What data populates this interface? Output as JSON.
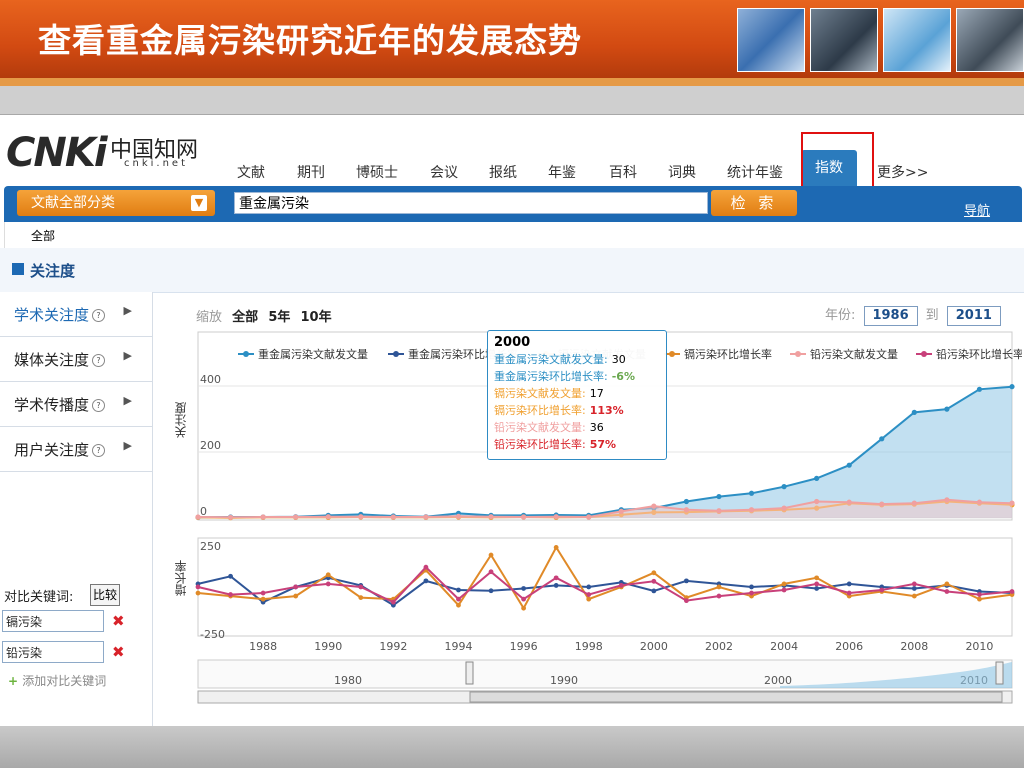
{
  "slide": {
    "title": "查看重金属污染研究近年的发展态势",
    "thumbnails": [
      "lab-photo",
      "researcher-photo",
      "world-map-photo",
      "classroom-photo"
    ]
  },
  "logo": {
    "main": "CNKi",
    "cn": "中国知网",
    "sub": "cnki.net"
  },
  "nav": {
    "items": [
      "文献",
      "期刊",
      "博硕士",
      "会议",
      "报纸",
      "年鉴",
      "百科",
      "词典",
      "统计年鉴",
      "指数",
      "更多>>"
    ],
    "active": "指数"
  },
  "search": {
    "category": "文献全部分类",
    "query": "重金属污染",
    "button": "检 索",
    "nav_link": "导航",
    "scope": "全部"
  },
  "section": {
    "title": "关注度"
  },
  "menu": [
    {
      "label": "学术关注度"
    },
    {
      "label": "媒体关注度"
    },
    {
      "label": "学术传播度"
    },
    {
      "label": "用户关注度"
    }
  ],
  "compare": {
    "label": "对比关键词:",
    "button": "比较",
    "keywords": [
      "镉污染",
      "铅污染"
    ],
    "add": "添加对比关键词"
  },
  "controls": {
    "zoom_label": "缩放",
    "zoom_options": [
      "全部",
      "5年",
      "10年"
    ],
    "year_label": "年份:",
    "year_from": "1986",
    "year_to_label": "到",
    "year_to": "2011"
  },
  "colors": {
    "heavy": "#2c8fc4",
    "heavy_rate": "#2f5597",
    "cd": "#f0a030",
    "cd_rate": "#e08a28",
    "pb": "#f0a0a0",
    "pb_rate": "#c8407a"
  },
  "chart_data": {
    "type": "line",
    "xlim": [
      1986,
      2011
    ],
    "legend": [
      "重金属污染文献发文量",
      "重金属污染环比增长率",
      "镉污染文献发文量",
      "镉污染环比增长率",
      "铅污染文献发文量",
      "铅污染环比增长率"
    ],
    "upper": {
      "ylabel": "关注度",
      "yticks": [
        0,
        200,
        400
      ],
      "series": [
        {
          "name": "重金属污染文献发文量",
          "x": [
            1986,
            1987,
            1988,
            1989,
            1990,
            1991,
            1992,
            1993,
            1994,
            1995,
            1996,
            1997,
            1998,
            1999,
            2000,
            2001,
            2002,
            2003,
            2004,
            2005,
            2006,
            2007,
            2008,
            2009,
            2010,
            2011
          ],
          "y": [
            2,
            3,
            3,
            4,
            8,
            11,
            6,
            4,
            14,
            8,
            8,
            9,
            8,
            25,
            30,
            50,
            65,
            75,
            95,
            120,
            160,
            240,
            320,
            330,
            390,
            398
          ]
        },
        {
          "name": "镉污染文献发文量",
          "x": [
            1986,
            1987,
            1988,
            1989,
            1990,
            1991,
            1992,
            1993,
            1994,
            1995,
            1996,
            1997,
            1998,
            1999,
            2000,
            2001,
            2002,
            2003,
            2004,
            2005,
            2006,
            2007,
            2008,
            2009,
            2010,
            2011
          ],
          "y": [
            2,
            1,
            2,
            2,
            2,
            3,
            2,
            2,
            3,
            2,
            3,
            2,
            3,
            10,
            17,
            18,
            20,
            22,
            25,
            30,
            45,
            40,
            42,
            50,
            45,
            40
          ]
        },
        {
          "name": "铅污染文献发文量",
          "x": [
            1986,
            1987,
            1988,
            1989,
            1990,
            1991,
            1992,
            1993,
            1994,
            1995,
            1996,
            1997,
            1998,
            1999,
            2000,
            2001,
            2002,
            2003,
            2004,
            2005,
            2006,
            2007,
            2008,
            2009,
            2010,
            2011
          ],
          "y": [
            3,
            2,
            3,
            3,
            4,
            4,
            3,
            3,
            5,
            4,
            3,
            4,
            3,
            20,
            36,
            25,
            22,
            25,
            30,
            50,
            48,
            42,
            45,
            55,
            48,
            45
          ]
        }
      ]
    },
    "lower": {
      "ylabel": "增长率",
      "yticks": [
        -250,
        250
      ],
      "xticks": [
        1988,
        1990,
        1992,
        1994,
        1996,
        1998,
        2000,
        2002,
        2004,
        2006,
        2008,
        2010
      ],
      "series": [
        {
          "name": "重金属污染环比增长率",
          "x": [
            1986,
            1987,
            1988,
            1989,
            1990,
            1991,
            1992,
            1993,
            1994,
            1995,
            1996,
            1997,
            1998,
            1999,
            2000,
            2001,
            2002,
            2003,
            2004,
            2005,
            2006,
            2007,
            2008,
            2009,
            2010,
            2011
          ],
          "y": [
            40,
            90,
            -80,
            20,
            80,
            30,
            -100,
            60,
            0,
            -5,
            10,
            30,
            20,
            50,
            -6,
            60,
            40,
            20,
            30,
            10,
            40,
            20,
            10,
            30,
            -10,
            -20
          ]
        },
        {
          "name": "镉污染环比增长率",
          "x": [
            1986,
            1987,
            1988,
            1989,
            1990,
            1991,
            1992,
            1993,
            1994,
            1995,
            1996,
            1997,
            1998,
            1999,
            2000,
            2001,
            2002,
            2003,
            2004,
            2005,
            2006,
            2007,
            2008,
            2009,
            2010,
            2011
          ],
          "y": [
            -20,
            -40,
            -60,
            -40,
            100,
            -50,
            -60,
            130,
            -100,
            230,
            -120,
            280,
            -60,
            20,
            113,
            -50,
            20,
            -40,
            40,
            80,
            -40,
            -10,
            -40,
            40,
            -60,
            -30
          ]
        },
        {
          "name": "铅污染环比增长率",
          "x": [
            1986,
            1987,
            1988,
            1989,
            1990,
            1991,
            1992,
            1993,
            1994,
            1995,
            1996,
            1997,
            1998,
            1999,
            2000,
            2001,
            2002,
            2003,
            2004,
            2005,
            2006,
            2007,
            2008,
            2009,
            2010,
            2011
          ],
          "y": [
            20,
            -30,
            -20,
            20,
            40,
            20,
            -80,
            150,
            -60,
            120,
            -60,
            80,
            -30,
            30,
            57,
            -70,
            -40,
            -20,
            0,
            40,
            -20,
            0,
            40,
            -10,
            -30,
            -10
          ]
        }
      ]
    },
    "tooltip": {
      "year": "2000",
      "rows": [
        {
          "label": "重金属污染文献发文量:",
          "value": "30",
          "color": "#2c8fc4"
        },
        {
          "label": "重金属污染环比增长率:",
          "value": "-6%",
          "color": "#2c8fc4"
        },
        {
          "label": "镉污染文献发文量:",
          "value": "17",
          "color": "#f0a030"
        },
        {
          "label": "镉污染环比增长率:",
          "value": "113%",
          "color": "#f0a030"
        },
        {
          "label": "铅污染文献发文量:",
          "value": "36",
          "color": "#f0a0a0"
        },
        {
          "label": "铅污染环比增长率:",
          "value": "57%",
          "color": "#d8232a"
        }
      ]
    },
    "navigator": {
      "labels": [
        "1980",
        "1990",
        "2000",
        "2010"
      ]
    }
  }
}
